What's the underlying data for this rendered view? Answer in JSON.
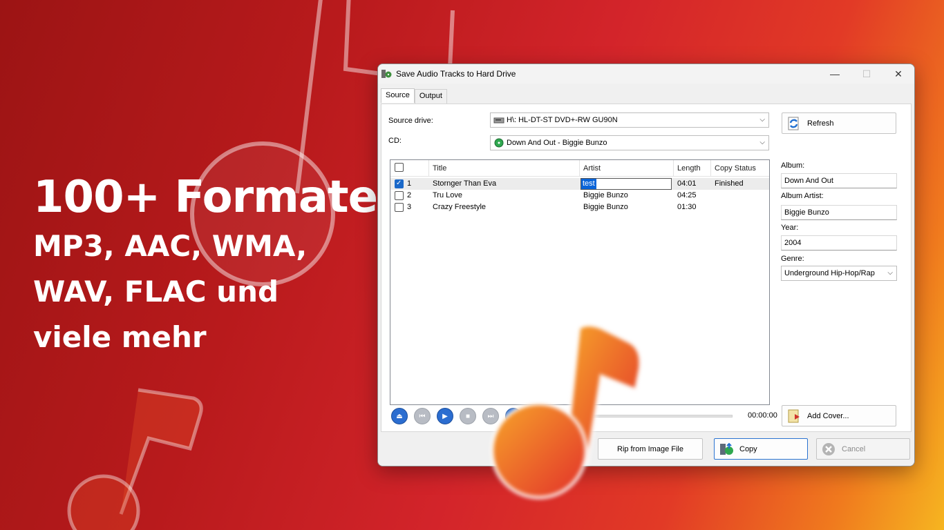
{
  "promo": {
    "headline": "100+ Formate",
    "line1": "MP3, AAC, WMA,",
    "line2": "WAV, FLAC und",
    "line3": "viele mehr"
  },
  "window": {
    "title": "Save Audio Tracks to Hard Drive",
    "tabs": [
      "Source",
      "Output"
    ],
    "source_drive_label": "Source drive:",
    "source_drive_value": "H\\: HL-DT-ST DVD+-RW GU90N",
    "cd_label": "CD:",
    "cd_value": "Down And Out - Biggie Bunzo",
    "refresh_label": "Refresh",
    "columns": [
      "Title",
      "Artist",
      "Length",
      "Copy Status"
    ],
    "tracks": [
      {
        "num": "1",
        "title": "Stornger Than Eva",
        "artist": "test",
        "length": "04:01",
        "status": "Finished",
        "checked": true
      },
      {
        "num": "2",
        "title": "Tru Love",
        "artist": "Biggie Bunzo",
        "length": "04:25",
        "status": "",
        "checked": false
      },
      {
        "num": "3",
        "title": "Crazy Freestyle",
        "artist": "Biggie Bunzo",
        "length": "01:30",
        "status": "",
        "checked": false
      }
    ],
    "player_time": "00:00:00",
    "album_label": "Album:",
    "album_value": "Down And Out",
    "album_artist_label": "Album Artist:",
    "album_artist_value": "Biggie Bunzo",
    "year_label": "Year:",
    "year_value": "2004",
    "genre_label": "Genre:",
    "genre_value": "Underground Hip-Hop/Rap",
    "add_cover_label": "Add Cover...",
    "rip_label": "Rip from Image File",
    "copy_label": "Copy",
    "cancel_label": "Cancel"
  },
  "colors": {
    "accent": "#1a68c9",
    "brand_red": "#c81e22",
    "brand_orange": "#f07a1e"
  }
}
